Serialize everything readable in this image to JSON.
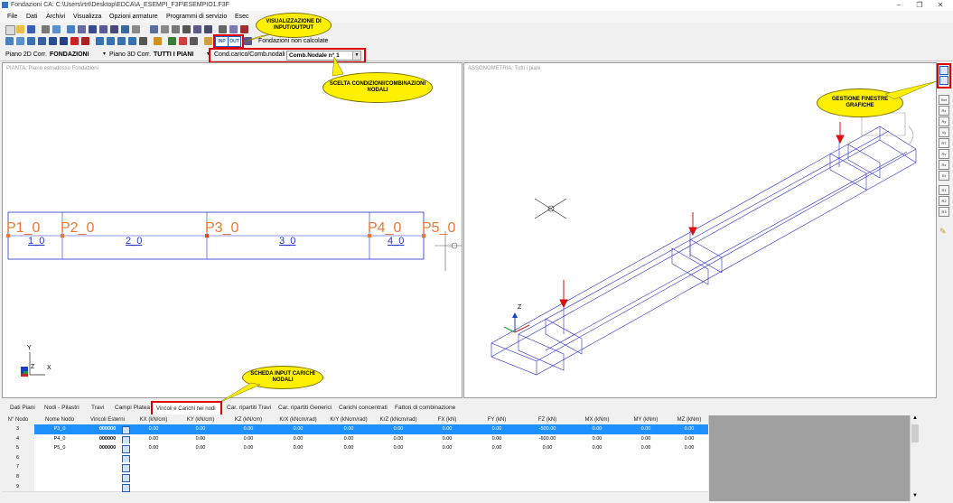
{
  "window": {
    "title": "Fondazioni CA:   C:\\Users\\rtrt\\Desktop\\EDCA\\A_ESEMPI_F3F\\ESEMPIO1.F3F",
    "minimize_icon": "minimize-icon",
    "maximize_icon": "restore-icon",
    "close_icon": "close-icon"
  },
  "menu": [
    "File",
    "Dati",
    "Archivi",
    "Visualizza",
    "Opzioni armature",
    "Programmi di servizio",
    "Esec"
  ],
  "toolbar": {
    "inp_label": "INP",
    "out_label": "OUT",
    "status_text": "Fondazioni non calcolate"
  },
  "options": {
    "piano2d_label": "Piano 2D Corr.",
    "piano2d_value": "FONDAZIONI",
    "piano3d_label": "Piano 3D Corr.",
    "piano3d_value": "TUTTI I PIANI",
    "cond_label": "Cond.carico/Comb.nodali",
    "comb_value": "Comb.Nodale n°  1"
  },
  "callouts": {
    "io": "VISUALIZZAZIONE DI INPUT/OUTPUT",
    "cond": "SCELTA CONDIZIONI/COMBINAZIONI NODALI",
    "windows": "GESTIONE FINESTRE GRAFICHE",
    "scheda": "SCHEDA INPUT CARICHI NODALI"
  },
  "plan_view": {
    "title": "PIANTA: Piano estradosso Fondazioni",
    "nodes": [
      "P1_0",
      "P2_0",
      "P3_0",
      "P4_0",
      "P5_0"
    ],
    "beams": [
      "1_0",
      "2_0",
      "3_0",
      "4_0"
    ],
    "axis_y": "Y",
    "axis_x": "X",
    "axis_z": "Z"
  },
  "iso_view": {
    "title": "ASSONOMETRIA: Tutti i piani",
    "axis_z": "Z"
  },
  "right_strip": [
    "Bet",
    "Rx",
    "Ry",
    "Vy",
    "RT",
    "Rv",
    "Rz",
    "Sx",
    "R1",
    "R2",
    "R3"
  ],
  "tabs": [
    "Dati Piani",
    "Nodi - Pilastri",
    "Travi",
    "Campi Platea",
    "Vincoli e Carichi nei nodi",
    "Car. ripartiti Travi",
    "Car. ripartiti Generici",
    "Carichi concentrati",
    "Fattori di combinazione"
  ],
  "active_tab": "Vincoli e Carichi nei nodi",
  "grid": {
    "columns": [
      "N° Nodo",
      "Nome Nodo",
      "Vincoli Esterni",
      "KX  (kN/cm)",
      "KY  (kN/cm)",
      "KZ  (kN/cm)",
      "KrX  (kNcm/rad)",
      "KrY  (kNcm/rad)",
      "KrZ  (kNcm/rad)",
      "FX  (kN)",
      "FY  (kN)",
      "FZ  (kN)",
      "MX  (kNm)",
      "MY  (kNm)",
      "MZ  (kNm)"
    ],
    "rows": [
      {
        "n": "3",
        "name": "P3_0",
        "vinc": "000000",
        "kx": "0.00",
        "ky": "0.00",
        "kz": "0.00",
        "krx": "0.00",
        "kry": "0.00",
        "krz": "0.00",
        "fx": "0.00",
        "fy": "0.00",
        "fz": "-500.00",
        "mx": "0.00",
        "my": "0.00",
        "mz": "0.00"
      },
      {
        "n": "4",
        "name": "P4_0",
        "vinc": "000000",
        "kx": "0.00",
        "ky": "0.00",
        "kz": "0.00",
        "krx": "0.00",
        "kry": "0.00",
        "krz": "0.00",
        "fx": "0.00",
        "fy": "0.00",
        "fz": "-600.00",
        "mx": "0.00",
        "my": "0.00",
        "mz": "0.00"
      },
      {
        "n": "5",
        "name": "P5_0",
        "vinc": "000000",
        "kx": "0.00",
        "ky": "0.00",
        "kz": "0.00",
        "krx": "0.00",
        "kry": "0.00",
        "krz": "0.00",
        "fx": "0.00",
        "fy": "0.00",
        "fz": "0.00",
        "mx": "0.00",
        "my": "0.00",
        "mz": "0.00"
      },
      {
        "n": "6"
      },
      {
        "n": "7"
      },
      {
        "n": "8"
      },
      {
        "n": "9"
      }
    ]
  },
  "colors": {
    "accent_red": "#e00000",
    "callout_yellow": "#ffef00",
    "plan_blue": "#2233cc",
    "node_orange": "#ee7733",
    "selection_blue": "#1e90ff"
  }
}
